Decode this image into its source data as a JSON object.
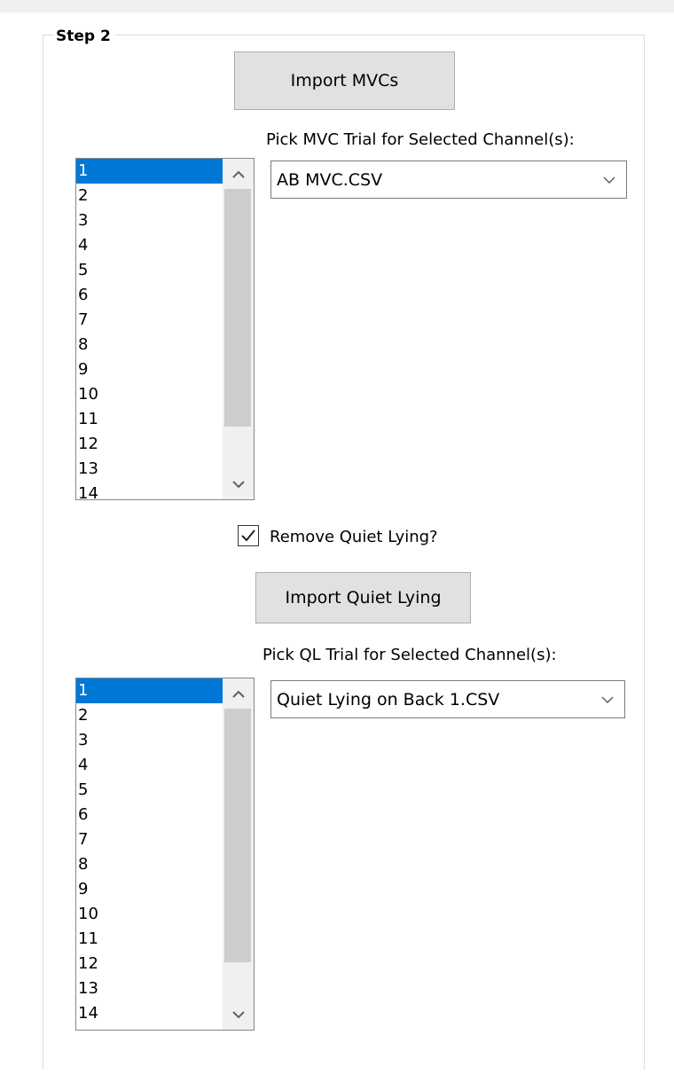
{
  "group": {
    "title": "Step 2"
  },
  "mvc": {
    "import_button": "Import MVCs",
    "pick_label": "Pick MVC Trial for Selected Channel(s):",
    "selected_file": "AB MVC.CSV",
    "channels": [
      "1",
      "2",
      "3",
      "4",
      "5",
      "6",
      "7",
      "8",
      "9",
      "10",
      "11",
      "12",
      "13",
      "14"
    ],
    "selected_index": 0
  },
  "quiet_lying": {
    "checkbox_label": "Remove Quiet Lying?",
    "checked": true,
    "import_button": "Import Quiet Lying",
    "pick_label": "Pick QL Trial for Selected Channel(s):",
    "selected_file": "Quiet Lying on Back 1.CSV",
    "channels": [
      "1",
      "2",
      "3",
      "4",
      "5",
      "6",
      "7",
      "8",
      "9",
      "10",
      "11",
      "12",
      "13",
      "14"
    ],
    "selected_index": 0
  },
  "icons": {
    "scroll_up": "chevron-up-icon",
    "scroll_down": "chevron-down-icon",
    "dropdown": "chevron-down-icon",
    "check": "checkmark-icon"
  },
  "colors": {
    "selection": "#0078d7",
    "button_face": "#e1e1e1",
    "scroll_thumb": "#cdcdcd"
  }
}
